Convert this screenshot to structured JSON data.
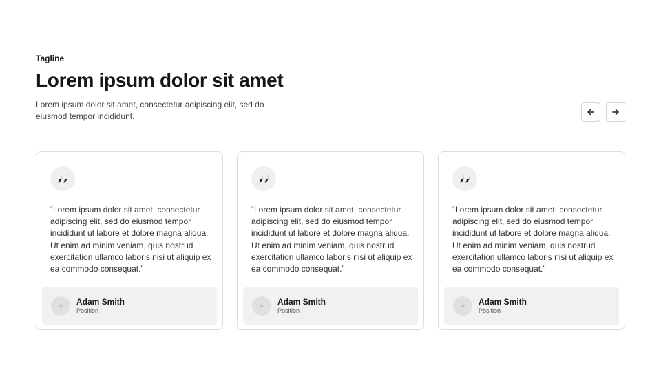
{
  "header": {
    "tagline": "Tagline",
    "title": "Lorem ipsum dolor sit amet",
    "description": "Lorem ipsum dolor sit amet, consectetur adipiscing elit, sed do eiusmod tempor incididunt."
  },
  "nav": {
    "prev_icon": "arrow-left-icon",
    "next_icon": "arrow-right-icon"
  },
  "testimonials": [
    {
      "quote": "“Lorem ipsum dolor sit amet, consectetur adipiscing elit, sed do eiusmod tempor incididunt ut labore et dolore magna aliqua. Ut enim ad minim veniam, quis nostrud exercitation ullamco laboris nisi ut aliquip ex ea commodo consequat.”",
      "name": "Adam Smith",
      "position": "Position"
    },
    {
      "quote": "“Lorem ipsum dolor sit amet, consectetur adipiscing elit, sed do eiusmod tempor incididunt ut labore et dolore magna aliqua. Ut enim ad minim veniam, quis nostrud exercitation ullamco laboris nisi ut aliquip ex ea commodo consequat.”",
      "name": "Adam Smith",
      "position": "Position"
    },
    {
      "quote": "“Lorem ipsum dolor sit amet, consectetur adipiscing elit, sed do eiusmod tempor incididunt ut labore et dolore magna aliqua. Ut enim ad minim veniam, quis nostrud exercitation ullamco laboris nisi ut aliquip ex ea commodo consequat.”",
      "name": "Adam Smith",
      "position": "Position"
    }
  ],
  "colors": {
    "text": "#1a1a1a",
    "border": "#dcdcdc",
    "author_bg": "#f1f1f1",
    "badge_bg": "#efefef"
  }
}
